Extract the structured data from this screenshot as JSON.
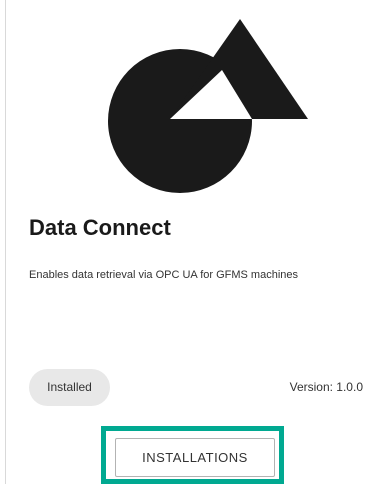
{
  "app": {
    "title": "Data Connect",
    "description": "Enables data retrieval via OPC UA for GFMS machines",
    "status": "Installed",
    "version": "Version: 1.0.0",
    "icon": "circle-triangle-logo-icon"
  },
  "actions": {
    "installations_label": "INSTALLATIONS"
  },
  "colors": {
    "highlight": "#00a991",
    "logo": "#1a1a1a",
    "badge_bg": "#e8e8e8"
  }
}
